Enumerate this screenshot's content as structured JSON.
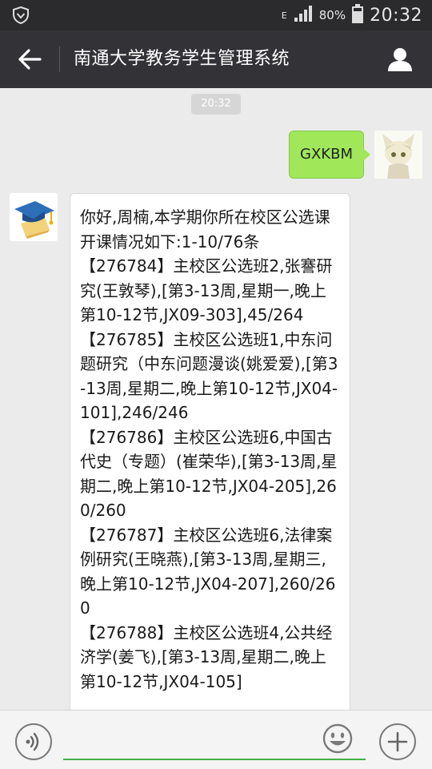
{
  "status_bar": {
    "network_type": "E",
    "battery_percent": "80%",
    "time": "20:32"
  },
  "header": {
    "title": "南通大学教务学生管理系统"
  },
  "chat": {
    "timestamp": "20:32",
    "sent_message": "GXKBM",
    "reply_lines": [
      "你好,周楠,本学期你所在校区公选课开课情况如下:1-10/76条",
      "【276784】主校区公选班2,张謇研究(王敦琴),[第3-13周,星期一,晚上第10-12节,JX09-303],45/264",
      "【276785】主校区公选班1,中东问题研究（中东问题漫谈(姚爱爱),[第3-13周,星期二,晚上第10-12节,JX04-101],246/246",
      "【276786】主校区公选班6,中国古代史（专题）(崔荣华),[第3-13周,星期二,晚上第10-12节,JX04-205],260/260",
      "【276787】主校区公选班6,法律案例研究(王晓燕),[第3-13周,星期三,晚上第10-12节,JX04-207],260/260",
      "【276788】主校区公选班4,公共经济学(姜飞),[第3-13周,星期二,晚上第10-12节,JX04-105]"
    ]
  },
  "input_bar": {
    "placeholder": ""
  },
  "icons": {
    "status": [
      "shield-icon",
      "signal-icon",
      "battery-icon"
    ],
    "header": [
      "back-arrow-icon",
      "user-profile-icon"
    ],
    "input": [
      "voice-icon",
      "emoji-icon",
      "plus-icon"
    ]
  },
  "colors": {
    "title_bar": "#333337",
    "status_bar": "#2b2b2d",
    "sent_bubble": "#a0e75a",
    "input_underline": "#43b14a",
    "chat_background": "#ebebeb"
  }
}
